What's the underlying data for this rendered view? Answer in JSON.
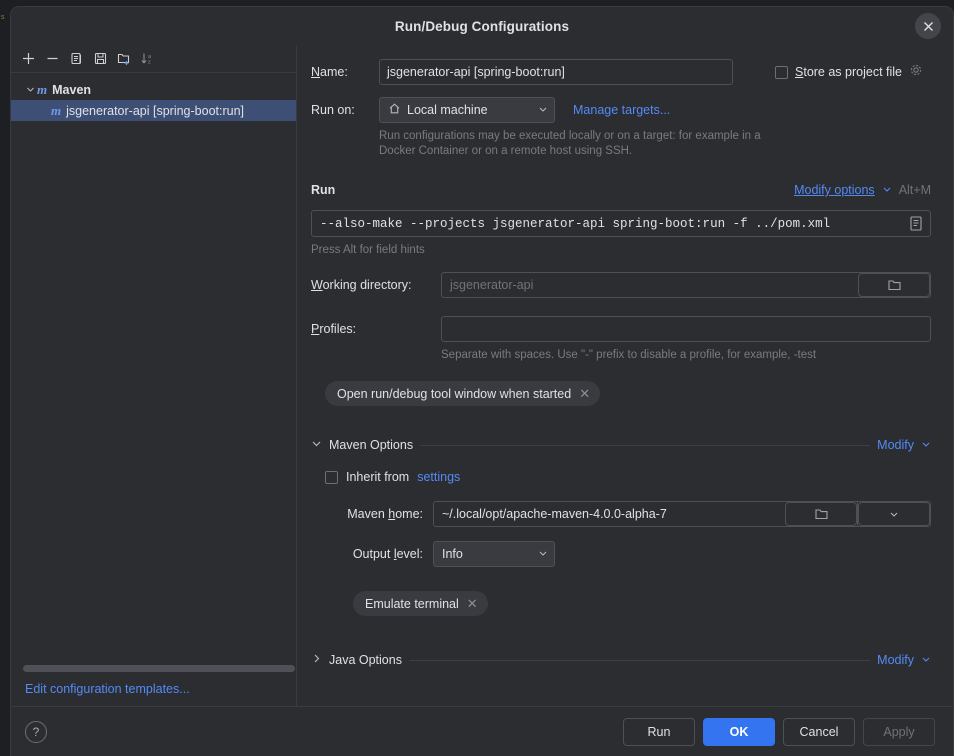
{
  "window": {
    "title": "Run/Debug Configurations",
    "close_icon": "close-icon"
  },
  "sidebar": {
    "toolbar": [
      {
        "icon": "add-icon",
        "name": "add-configuration-button"
      },
      {
        "icon": "remove-icon",
        "name": "remove-configuration-button"
      },
      {
        "icon": "copy-icon",
        "name": "copy-configuration-button"
      },
      {
        "icon": "save-icon",
        "name": "save-configuration-button"
      },
      {
        "icon": "new-folder-icon",
        "name": "new-folder-button"
      },
      {
        "icon": "sort-alpha-icon",
        "name": "sort-configurations-button"
      }
    ],
    "tree": [
      {
        "label": "Maven",
        "type": "group",
        "icon": "maven-icon",
        "expanded": true
      },
      {
        "label": "jsgenerator-api [spring-boot:run]",
        "type": "child",
        "icon": "maven-icon",
        "selected": true
      }
    ],
    "edit_templates_label": "Edit configuration templates..."
  },
  "form": {
    "name_label": "Name:",
    "name_label_accel": "N",
    "name_value": "jsgenerator-api [spring-boot:run]",
    "store_as_project_file_label": "Store as project file",
    "store_as_project_file_accel": "S",
    "store_as_project_file_checked": false,
    "store_gear_icon": "gear-icon",
    "run_on_label": "Run on:",
    "run_on_value": "Local machine",
    "run_on_icon": "home-icon",
    "manage_targets_label": "Manage targets...",
    "run_on_hint": "Run configurations may be executed locally or on a target: for example in a Docker Container or on a remote host using SSH.",
    "run_section_title": "Run",
    "modify_options_label": "Modify options",
    "modify_options_accel": "o",
    "modify_options_shortcut": "Alt+M",
    "command_value": "--also-make --projects jsgenerator-api spring-boot:run -f ../pom.xml",
    "command_end_icon": "expand-editor-icon",
    "command_hint": "Press Alt for field hints",
    "working_directory_label": "Working directory:",
    "working_directory_accel": "W",
    "working_directory_placeholder": "jsgenerator-api",
    "working_directory_icon": "folder-icon",
    "profiles_label": "Profiles:",
    "profiles_accel": "P",
    "profiles_value": "",
    "profiles_hint": "Separate with spaces. Use \"-\" prefix to disable a profile, for example, -test",
    "tag_open_tool_window": "Open run/debug tool window when started"
  },
  "maven_options": {
    "section_title": "Maven Options",
    "modify_label": "Modify",
    "expanded": true,
    "inherit_from_label": "Inherit from",
    "inherit_from_link": "settings",
    "inherit_checked": false,
    "maven_home_label": "Maven home:",
    "maven_home_accel": "h",
    "maven_home_value": "~/.local/opt/apache-maven-4.0.0-alpha-7",
    "maven_home_folder_icon": "folder-icon",
    "maven_home_chevron_icon": "chevron-down-icon",
    "output_level_label": "Output level:",
    "output_level_accel": "l",
    "output_level_value": "Info",
    "tag_emulate_terminal": "Emulate terminal"
  },
  "java_options": {
    "section_title": "Java Options",
    "modify_label": "Modify",
    "expanded": false
  },
  "footer": {
    "help_label": "?",
    "run_label": "Run",
    "ok_label": "OK",
    "cancel_label": "Cancel",
    "apply_label": "Apply",
    "apply_enabled": false
  },
  "colors": {
    "accent": "#3574f0",
    "link": "#548af7",
    "dialog_bg": "#2b2d30",
    "selection": "#3e4f75",
    "desktop_bg": "#1e1f22"
  }
}
